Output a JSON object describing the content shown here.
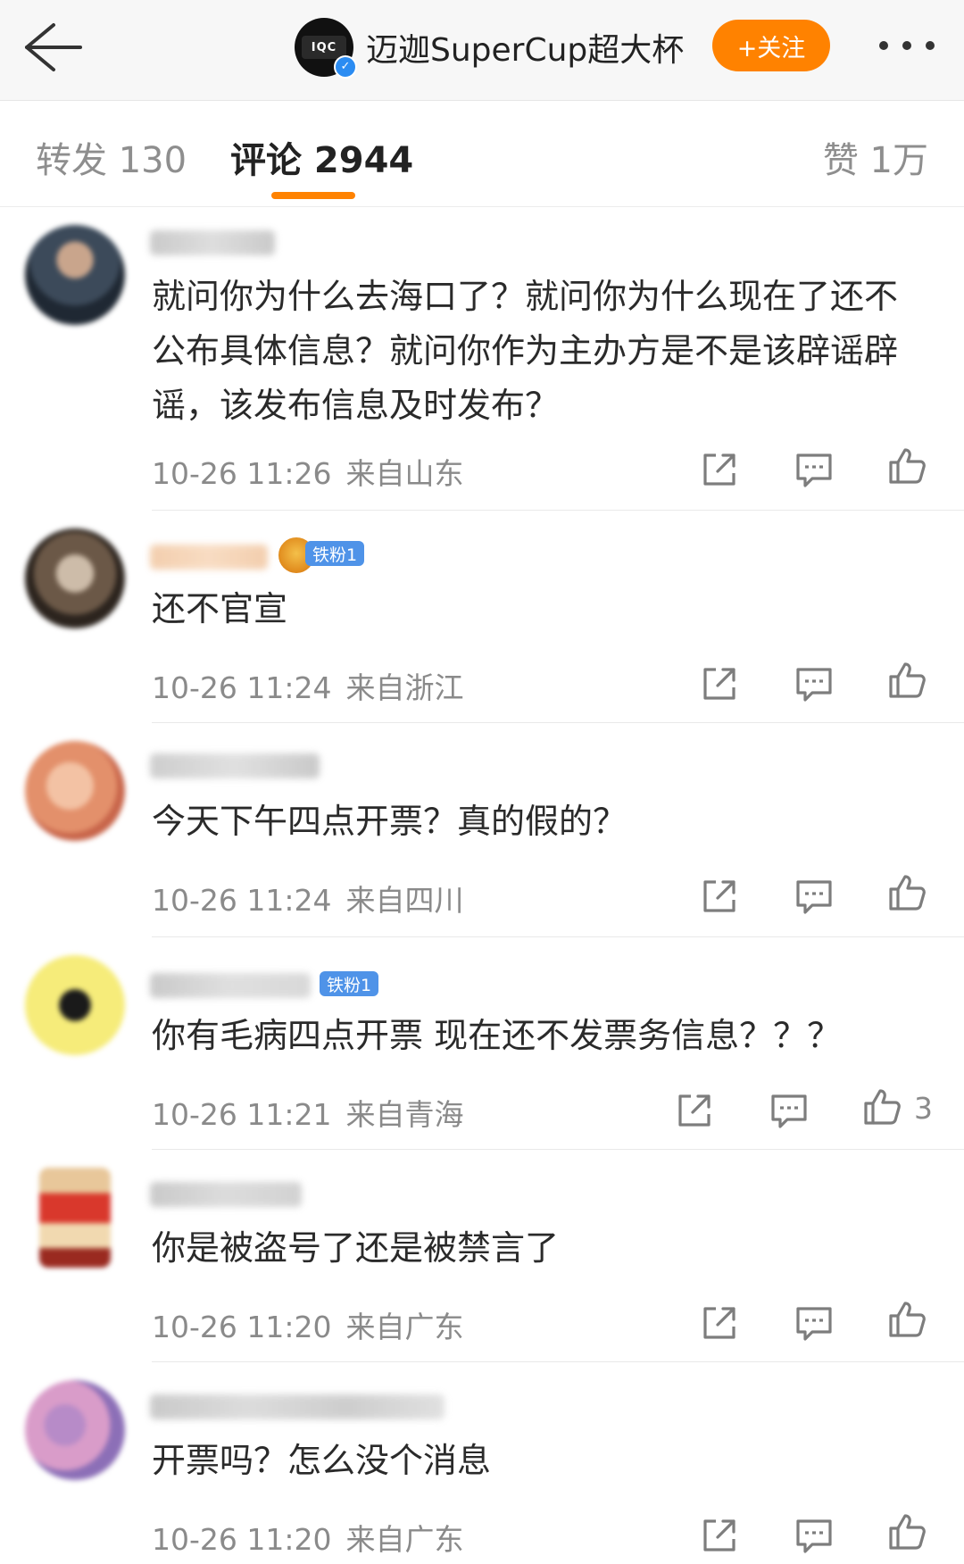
{
  "topbar": {
    "account_name": "迈迦SuperCup超大杯",
    "follow_label": "+关注",
    "logo_text": "IQC"
  },
  "tabs": {
    "repost": "转发 130",
    "comments": "评论 2944",
    "likes": "赞 1万"
  },
  "colors": {
    "accent": "#ff8200",
    "badge": "#4f93e8",
    "meta": "#8a8a8a"
  },
  "icons": [
    "back-arrow-icon",
    "more-icon",
    "share-icon",
    "comment-icon",
    "like-icon",
    "verified-icon"
  ],
  "comments": [
    {
      "text": "就问你为什么去海口了？就问你为什么现在了还不公布具体信息？就问你作为主办方是不是该辟谣辟谣，该发布信息及时发布？",
      "time": "10-26 11:26",
      "location": "来自山东",
      "likes": ""
    },
    {
      "badge": "铁粉1",
      "text": "还不官宣",
      "time": "10-26 11:24",
      "location": "来自浙江",
      "likes": ""
    },
    {
      "text": "今天下午四点开票？真的假的？",
      "time": "10-26 11:24",
      "location": "来自四川",
      "likes": ""
    },
    {
      "badge": "铁粉1",
      "text": "你有毛病四点开票 现在还不发票务信息？？？",
      "time": "10-26 11:21",
      "location": "来自青海",
      "likes": "3"
    },
    {
      "text": "你是被盗号了还是被禁言了",
      "time": "10-26 11:20",
      "location": "来自广东",
      "likes": ""
    },
    {
      "text": "开票吗？怎么没个消息",
      "time": "10-26 11:20",
      "location": "来自广东",
      "likes": ""
    }
  ]
}
